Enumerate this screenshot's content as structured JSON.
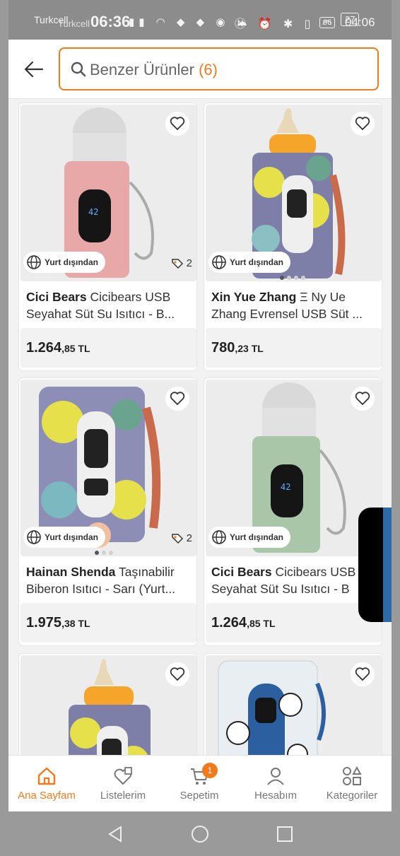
{
  "status_bar": {
    "carrier": "Turkcell",
    "carrier2": "Turkcell",
    "time_big": "06:36",
    "time": "04:06",
    "battery_left": "96",
    "battery_right": "27"
  },
  "header": {
    "search_text": "Benzer Ürünler",
    "search_count": "(6)"
  },
  "products": [
    {
      "brand": "Cici Bears",
      "title_rest": " Cicibears USB Seyahat Süt Su Isıtıcı - B...",
      "line1_brand": "Cici Bears",
      "line1_rest": "Cicibears USB",
      "line2": "Seyahat Süt Su Isıtıcı - B...",
      "origin": "Yurt dışından",
      "tag_count": "2",
      "price_main": "1.264",
      "price_rest": ",85 TL",
      "dots": false,
      "colors": {
        "sleeve": "#e8a8a8"
      }
    },
    {
      "line1_brand": "Xin Yue Zhang",
      "line1_rest": "Ξ Ny Ue",
      "line2": "Zhang Evrensel USB Süt ...",
      "origin": "Yurt dışından",
      "tag_count": "",
      "price_main": "780",
      "price_rest": ",23 TL",
      "dots": true,
      "colors": {
        "sleeve": "camo"
      }
    },
    {
      "line1_brand": "Hainan Shenda",
      "line1_rest": "Taşınabilir",
      "line2": "Biberon Isıtıcı - Sarı (Yurt...",
      "origin": "Yurt dışından",
      "tag_count": "2",
      "price_main": "1.975",
      "price_rest": ",38 TL",
      "dots": true,
      "colors": {
        "sleeve": "camo"
      }
    },
    {
      "line1_brand": "Cici Bears",
      "line1_rest": "Cicibears USB",
      "line2": "Seyahat Süt Su Isıtıcı - B",
      "origin": "Yurt dışından",
      "tag_count": "",
      "price_main": "1.264",
      "price_rest": ",85 TL",
      "dots": false,
      "colors": {
        "sleeve": "#a9c7a8"
      }
    }
  ],
  "bottom_nav": [
    {
      "label": "Ana Sayfam",
      "icon": "home-icon",
      "active": true
    },
    {
      "label": "Listelerim",
      "icon": "list-heart-icon",
      "active": false
    },
    {
      "label": "Sepetim",
      "icon": "cart-icon",
      "active": false,
      "badge": "1"
    },
    {
      "label": "Hesabım",
      "icon": "user-icon",
      "active": false
    },
    {
      "label": "Kategoriler",
      "icon": "categories-icon",
      "active": false
    }
  ],
  "accent_color": "#f27a1a"
}
